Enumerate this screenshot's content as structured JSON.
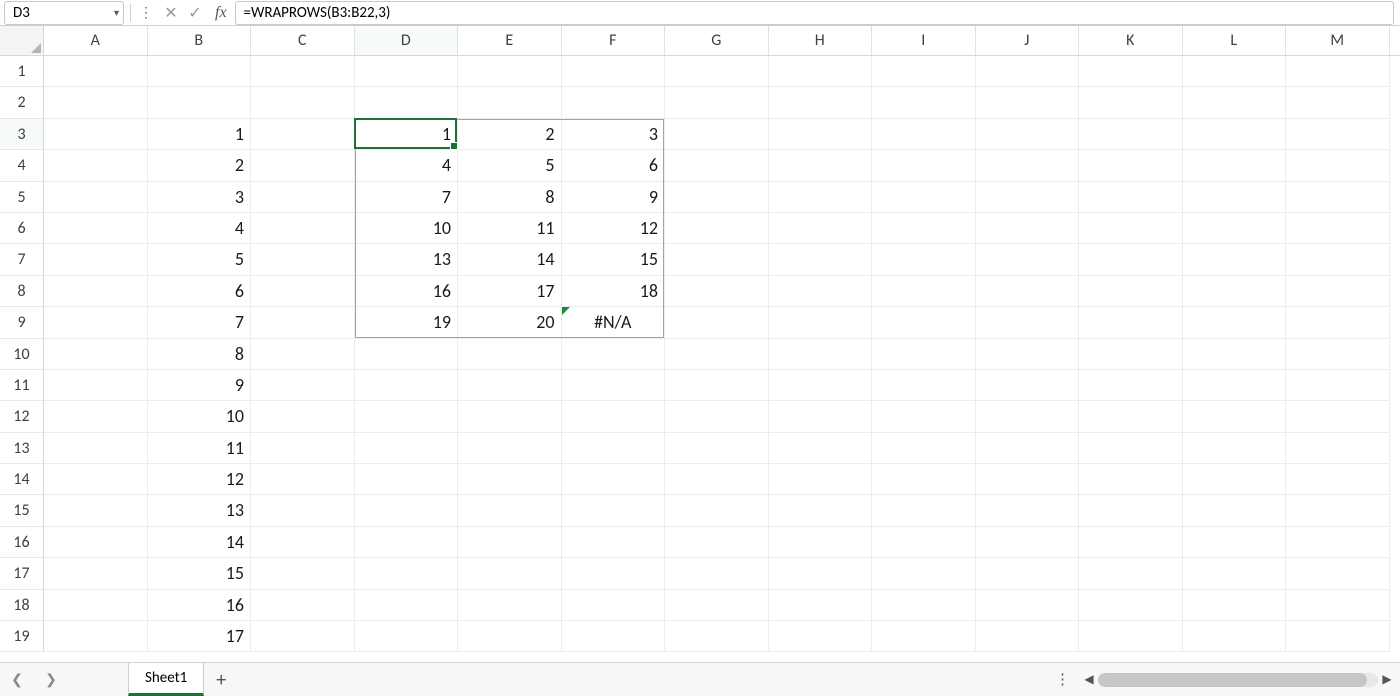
{
  "nameBox": "D3",
  "formula": "=WRAPROWS(B3:B22,3)",
  "columns": [
    "A",
    "B",
    "C",
    "D",
    "E",
    "F",
    "G",
    "H",
    "I",
    "J",
    "K",
    "L",
    "M"
  ],
  "rowCount": 19,
  "activeCell": {
    "col": 3,
    "row": 2
  },
  "spill": {
    "col0": 3,
    "row0": 2,
    "col1": 5,
    "row1": 8
  },
  "cells": {
    "B3": "1",
    "B4": "2",
    "B5": "3",
    "B6": "4",
    "B7": "5",
    "B8": "6",
    "B9": "7",
    "B10": "8",
    "B11": "9",
    "B12": "10",
    "B13": "11",
    "B14": "12",
    "B15": "13",
    "B16": "14",
    "B17": "15",
    "B18": "16",
    "B19": "17",
    "D3": "1",
    "E3": "2",
    "F3": "3",
    "D4": "4",
    "E4": "5",
    "F4": "6",
    "D5": "7",
    "E5": "8",
    "F5": "9",
    "D6": "10",
    "E6": "11",
    "F6": "12",
    "D7": "13",
    "E7": "14",
    "F7": "15",
    "D8": "16",
    "E8": "17",
    "F8": "18",
    "D9": "19",
    "E9": "20",
    "F9": "#N/A"
  },
  "errorCells": [
    "F9"
  ],
  "centerCells": [
    "F9"
  ],
  "sheetTab": "Sheet1"
}
